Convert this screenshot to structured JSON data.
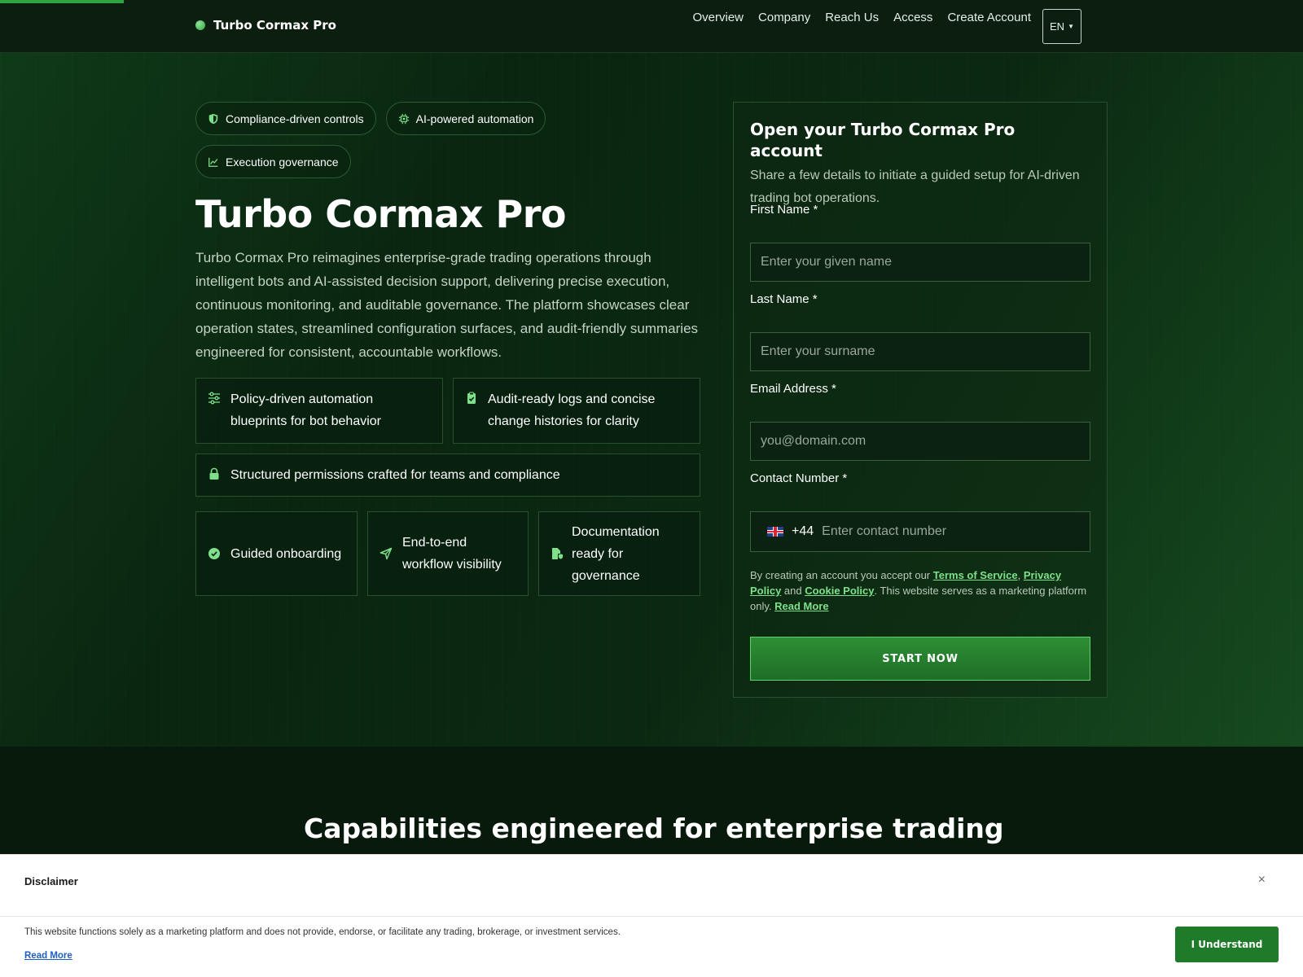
{
  "progress": {
    "fraction": 0.095
  },
  "header": {
    "brand": "Turbo Cormax Pro",
    "nav": [
      "Overview",
      "Company",
      "Reach Us",
      "Access",
      "Create Account"
    ],
    "language": "EN"
  },
  "hero": {
    "pills": [
      "Compliance-driven controls",
      "AI-powered automation",
      "Execution governance"
    ],
    "title": "Turbo Cormax Pro",
    "description": "Turbo Cormax Pro reimagines enterprise-grade trading operations through intelligent bots and AI-assisted decision support, delivering precise execution, continuous monitoring, and auditable governance. The platform showcases clear operation states, streamlined configuration surfaces, and audit-friendly summaries engineered for consistent, accountable workflows.",
    "features": [
      "Policy-driven automation blueprints for bot behavior",
      "Audit-ready logs and concise change histories for clarity",
      "Structured permissions crafted for teams and compliance",
      "Guided onboarding",
      "End-to-end workflow visibility",
      "Documentation ready for governance"
    ]
  },
  "signup": {
    "title": "Open your Turbo Cormax Pro account",
    "subtitle": "Share a few details to initiate a guided setup for AI-driven trading bot operations.",
    "first_name_label": "First Name *",
    "first_name_placeholder": "Enter your given name",
    "last_name_label": "Last Name *",
    "last_name_placeholder": "Enter your surname",
    "email_label": "Email Address *",
    "email_placeholder": "you@domain.com",
    "phone_label": "Contact Number *",
    "dial_code": "+44",
    "phone_placeholder": "Enter contact number",
    "consent_prefix": "By creating an account you accept our ",
    "terms": "Terms of Service",
    "comma": ",",
    "privacy": "Privacy Policy",
    "and": " and ",
    "cookie": "Cookie Policy",
    "consent_suffix": ". This website serves as a marketing platform only. ",
    "read_more": "Read More",
    "button": "START NOW"
  },
  "capabilities": {
    "title": "Capabilities engineered for enterprise trading"
  },
  "disclaimer": {
    "title": "Disclaimer",
    "close": "×",
    "text": "This website functions solely as a marketing platform and does not provide, endorse, or facilitate any trading, brokerage, or investment services.",
    "read_more": "Read More",
    "button": "I Understand"
  },
  "colors": {
    "accent": "#2fa33f",
    "icon": "#7fe08c",
    "background": "#071a0c",
    "button": "#1f7a2a"
  },
  "icons": [
    "shield-icon",
    "chip-icon",
    "chart-line-icon",
    "sliders-icon",
    "clipboard-check-icon",
    "lock-icon",
    "check-circle-icon",
    "send-icon",
    "document-shield-icon",
    "uk-flag-icon"
  ]
}
